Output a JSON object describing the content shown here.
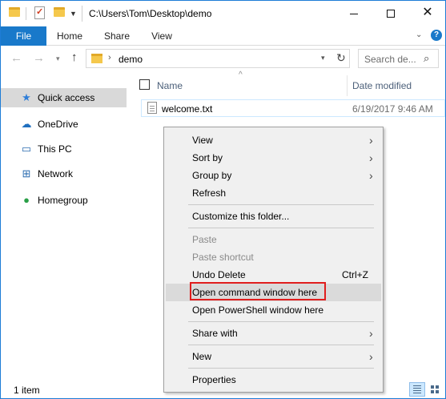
{
  "titlebar": {
    "path": "C:\\Users\\Tom\\Desktop\\demo",
    "minimize_icon": "minimize-icon",
    "maximize_icon": "maximize-icon",
    "close_glyph": "✕"
  },
  "ribbon": {
    "tabs": [
      {
        "label": "File"
      },
      {
        "label": "Home"
      },
      {
        "label": "Share"
      },
      {
        "label": "View"
      }
    ],
    "help_glyph": "?"
  },
  "address": {
    "location": "demo",
    "search_placeholder": "Search de..."
  },
  "sidebar": {
    "items": [
      {
        "label": "Quick access",
        "icon": "star-icon"
      },
      {
        "label": "OneDrive",
        "icon": "cloud-icon"
      },
      {
        "label": "This PC",
        "icon": "computer-icon"
      },
      {
        "label": "Network",
        "icon": "network-icon"
      },
      {
        "label": "Homegroup",
        "icon": "homegroup-icon"
      }
    ]
  },
  "content": {
    "columns": {
      "name": "Name",
      "date": "Date modified"
    },
    "files": [
      {
        "name": "welcome.txt",
        "date": "6/19/2017 9:46 AM"
      }
    ]
  },
  "status": {
    "count": "1 item"
  },
  "context_menu": {
    "items": [
      {
        "label": "View"
      },
      {
        "label": "Sort by"
      },
      {
        "label": "Group by"
      },
      {
        "label": "Refresh"
      },
      {
        "label": "Customize this folder..."
      },
      {
        "label": "Paste"
      },
      {
        "label": "Paste shortcut"
      },
      {
        "label": "Undo Delete",
        "shortcut": "Ctrl+Z"
      },
      {
        "label": "Open command window here"
      },
      {
        "label": "Open PowerShell window here"
      },
      {
        "label": "Share with"
      },
      {
        "label": "New"
      },
      {
        "label": "Properties"
      }
    ]
  },
  "colors": {
    "accent": "#1979ca",
    "highlight_border": "#e01e1e",
    "selection": "#cce8ff"
  }
}
